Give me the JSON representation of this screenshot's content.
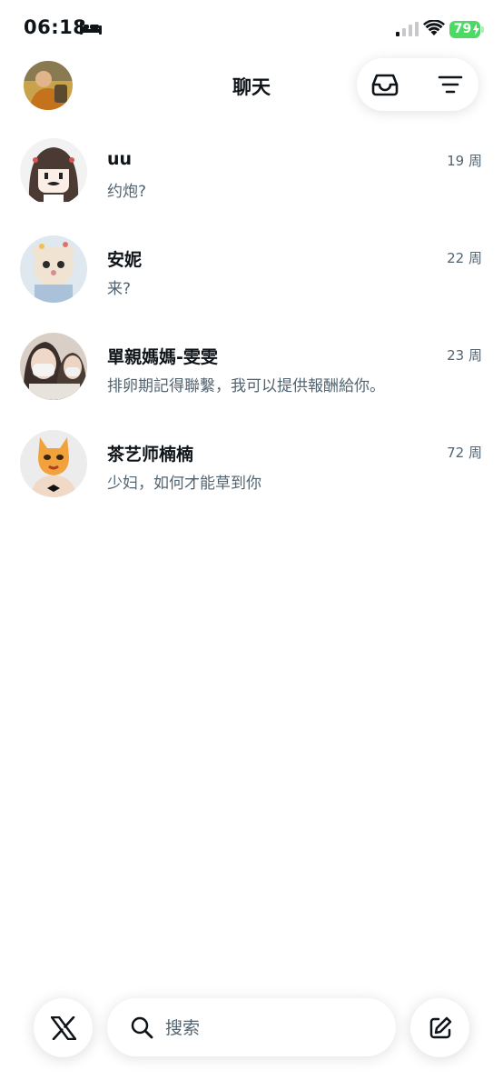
{
  "status_bar": {
    "time": "06:18",
    "battery": "79",
    "battery_color": "#4cd964"
  },
  "header": {
    "title": "聊天",
    "avatar_icon": "profile-avatar",
    "inbox_icon": "inbox-icon",
    "filter_icon": "filter-icon"
  },
  "conversations": [
    {
      "name": "uu",
      "time": "19 周",
      "preview": "约炮?"
    },
    {
      "name": "安妮",
      "time": "22 周",
      "preview": "来?"
    },
    {
      "name": "單親媽媽-雯雯",
      "time": "23 周",
      "preview": "排卵期記得聯繫，我可以提供報酬給你。"
    },
    {
      "name": "茶艺师楠楠",
      "time": "72 周",
      "preview": "少妇，如何才能草到你"
    }
  ],
  "bottom_bar": {
    "search_placeholder": "搜索",
    "x_icon": "x-logo-icon",
    "compose_icon": "compose-icon"
  },
  "colors": {
    "text_primary": "#0f1419",
    "text_secondary": "#536471",
    "background": "#ffffff"
  }
}
